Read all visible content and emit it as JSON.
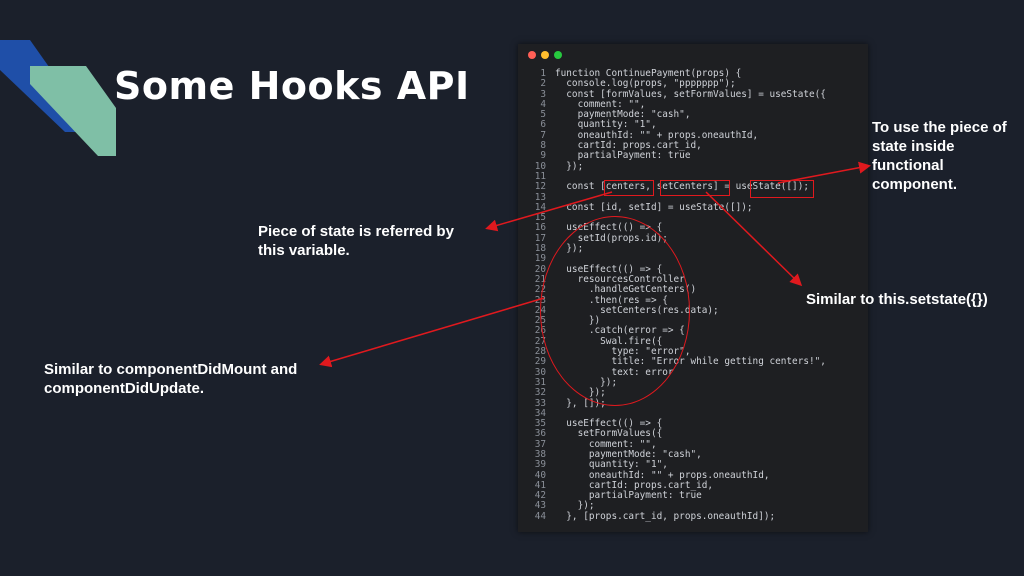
{
  "slide": {
    "title": "Some Hooks API"
  },
  "annotations": {
    "piece_of_state": "Piece of state is referred by this variable.",
    "component_did_mount": "Similar to componentDidMount and componentDidUpdate.",
    "use_state_inside": "To use the piece of state inside functional component.",
    "similar_setstate": "Similar to this.setstate({})"
  },
  "code": {
    "lines": [
      {
        "n": "1",
        "text": "function ContinuePayment(props) {"
      },
      {
        "n": "2",
        "text": "  console.log(props, \"ppppppp\");"
      },
      {
        "n": "3",
        "text": "  const [formValues, setFormValues] = useState({"
      },
      {
        "n": "4",
        "text": "    comment: \"\","
      },
      {
        "n": "5",
        "text": "    paymentMode: \"cash\","
      },
      {
        "n": "6",
        "text": "    quantity: \"1\","
      },
      {
        "n": "7",
        "text": "    oneauthId: \"\" + props.oneauthId,"
      },
      {
        "n": "8",
        "text": "    cartId: props.cart_id,"
      },
      {
        "n": "9",
        "text": "    partialPayment: true"
      },
      {
        "n": "10",
        "text": "  });"
      },
      {
        "n": "11",
        "text": ""
      },
      {
        "n": "12",
        "text": "  const [centers, setCenters] = useState([]);"
      },
      {
        "n": "13",
        "text": ""
      },
      {
        "n": "14",
        "text": "  const [id, setId] = useState([]);"
      },
      {
        "n": "15",
        "text": ""
      },
      {
        "n": "16",
        "text": "  useEffect(() => {"
      },
      {
        "n": "17",
        "text": "    setId(props.id);"
      },
      {
        "n": "18",
        "text": "  });"
      },
      {
        "n": "19",
        "text": ""
      },
      {
        "n": "20",
        "text": "  useEffect(() => {"
      },
      {
        "n": "21",
        "text": "    resourcesController"
      },
      {
        "n": "22",
        "text": "      .handleGetCenters()"
      },
      {
        "n": "23",
        "text": "      .then(res => {"
      },
      {
        "n": "24",
        "text": "        setCenters(res.data);"
      },
      {
        "n": "25",
        "text": "      })"
      },
      {
        "n": "26",
        "text": "      .catch(error => {"
      },
      {
        "n": "27",
        "text": "        Swal.fire({"
      },
      {
        "n": "28",
        "text": "          type: \"error\","
      },
      {
        "n": "29",
        "text": "          title: \"Error while getting centers!\","
      },
      {
        "n": "30",
        "text": "          text: error"
      },
      {
        "n": "31",
        "text": "        });"
      },
      {
        "n": "32",
        "text": "      });"
      },
      {
        "n": "33",
        "text": "  }, []);"
      },
      {
        "n": "34",
        "text": ""
      },
      {
        "n": "35",
        "text": "  useEffect(() => {"
      },
      {
        "n": "36",
        "text": "    setFormValues({"
      },
      {
        "n": "37",
        "text": "      comment: \"\","
      },
      {
        "n": "38",
        "text": "      paymentMode: \"cash\","
      },
      {
        "n": "39",
        "text": "      quantity: \"1\","
      },
      {
        "n": "40",
        "text": "      oneauthId: \"\" + props.oneauthId,"
      },
      {
        "n": "41",
        "text": "      cartId: props.cart_id,"
      },
      {
        "n": "42",
        "text": "      partialPayment: true"
      },
      {
        "n": "43",
        "text": "    });"
      },
      {
        "n": "44",
        "text": "  }, [props.cart_id, props.oneauthId]);"
      }
    ]
  },
  "colors": {
    "background": "#1b202b",
    "highlight": "#e0191e",
    "accent_blue": "#1f4fa8",
    "accent_teal": "#7fbfa6"
  }
}
